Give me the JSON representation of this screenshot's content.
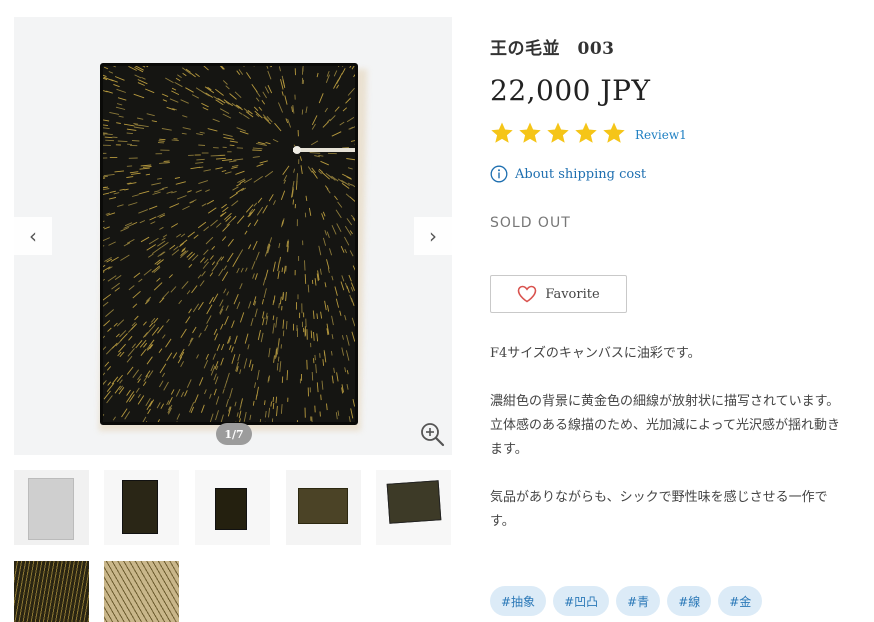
{
  "product": {
    "title": "王の毛並　003",
    "price": "22,000 JPY",
    "rating": 5,
    "review_label": "Review1",
    "shipping_label": "About shipping cost",
    "status": "SOLD OUT",
    "favorite_label": "Favorite"
  },
  "gallery": {
    "counter": "1/7",
    "prev_icon": "chevron-left-icon",
    "next_icon": "chevron-right-icon",
    "zoom_icon": "zoom-in-icon",
    "thumbnails": [
      "thumb-1",
      "thumb-2",
      "thumb-3",
      "thumb-4",
      "thumb-5",
      "thumb-6",
      "thumb-7"
    ]
  },
  "description": {
    "p1": "F4サイズのキャンバスに油彩です。",
    "p2a": "濃紺色の背景に黄金色の細線が放射状に描写されています。",
    "p2b": "立体感のある線描のため、光加減によって光沢感が揺れ動きます。",
    "p3": "気品がありながらも、シックで野性味を感じさせる一作です。"
  },
  "tags": [
    "#抽象",
    "#凹凸",
    "#青",
    "#線",
    "#金"
  ],
  "colors": {
    "star": "#f5c518",
    "link": "#1e7fc2",
    "tag_bg": "#dcebf7",
    "tag_text": "#2c79b8",
    "heart": "#d9534f"
  }
}
